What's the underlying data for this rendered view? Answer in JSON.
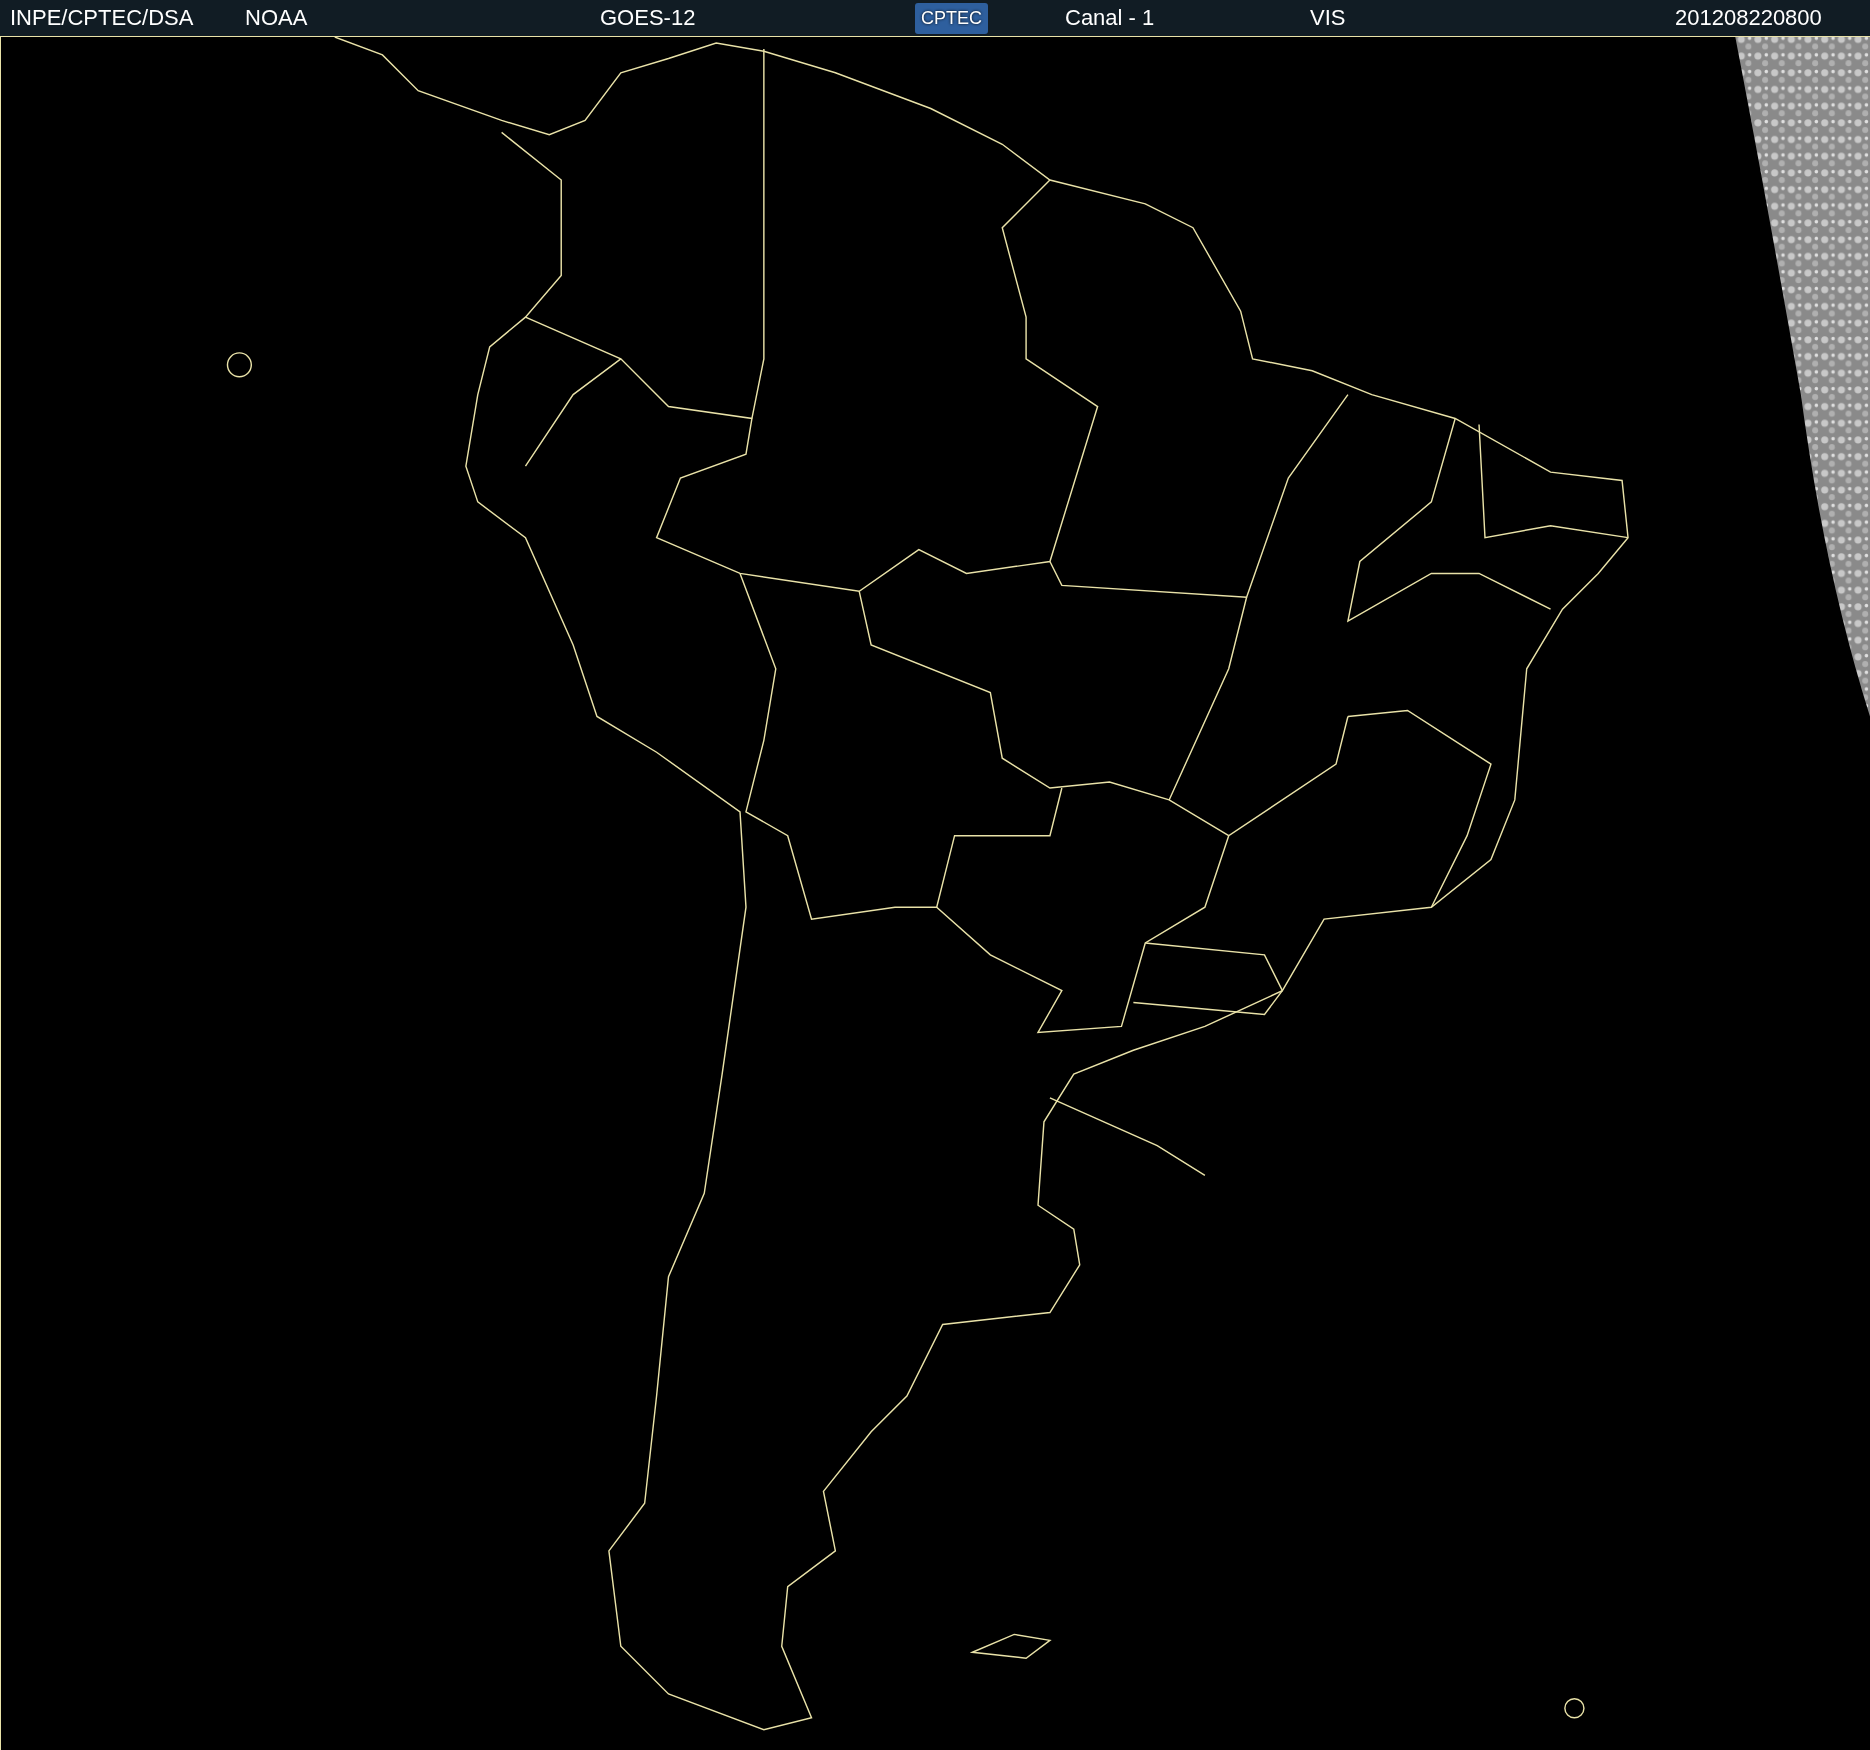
{
  "header": {
    "items": [
      {
        "kind": "text",
        "text": "INPE/CPTEC/DSA"
      },
      {
        "kind": "text",
        "text": "NOAA"
      },
      {
        "kind": "text",
        "text": "GOES-12"
      },
      {
        "kind": "logo",
        "text": "CPTEC"
      },
      {
        "kind": "text",
        "text": "Canal - 1"
      },
      {
        "kind": "text",
        "text": "VIS"
      },
      {
        "kind": "text",
        "text": "201208220800"
      }
    ]
  }
}
